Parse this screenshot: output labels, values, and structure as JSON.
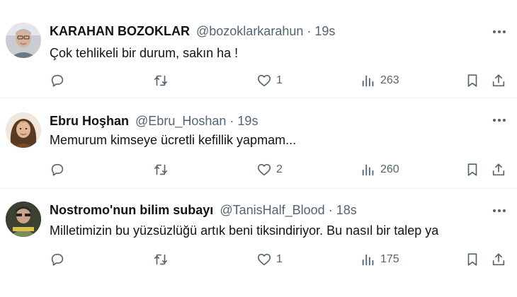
{
  "tweets": [
    {
      "name": "KARAHAN BOZOKLAR",
      "handle": "@bozoklarkarahun",
      "separator": "·",
      "time": "19s",
      "text": "Çok tehlikeli bir durum, sakın ha !",
      "replies": "",
      "retweets": "",
      "likes": "1",
      "views": "263"
    },
    {
      "name": "Ebru Hoşhan",
      "handle": "@Ebru_Hoshan",
      "separator": "·",
      "time": "19s",
      "text": "Memurum kimseye ücretli kefillik yapmam...",
      "replies": "",
      "retweets": "",
      "likes": "2",
      "views": "260"
    },
    {
      "name": "Nostromo'nun bilim subayı",
      "handle": "@TanisHalf_Blood",
      "separator": "·",
      "time": "18s",
      "text": "Milletimizin bu yüzsüzlüğü artık beni tiksindiriyor. Bu nasıl bir talep ya",
      "replies": "",
      "retweets": "",
      "likes": "1",
      "views": "175"
    }
  ],
  "icons": {
    "more": "more-horizontal-icon",
    "reply": "reply-icon",
    "retweet": "retweet-icon",
    "like": "heart-icon",
    "views": "views-icon",
    "bookmark": "bookmark-icon",
    "share": "share-icon"
  },
  "colors": {
    "text_primary": "#0f1419",
    "text_secondary": "#536471",
    "divider": "#eff3f4"
  }
}
